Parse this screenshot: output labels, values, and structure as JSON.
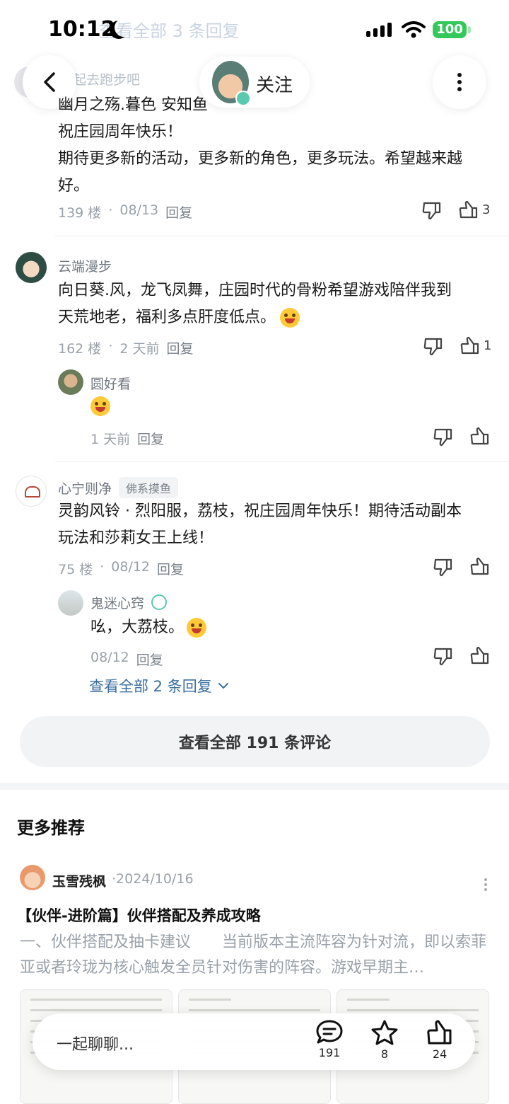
{
  "status": {
    "time": "10:12",
    "battery": "100"
  },
  "scroll_hint": "查看全部 3 条回复",
  "header": {
    "follow_label": "关注",
    "faded_title": "一起去跑步吧"
  },
  "comments": [
    {
      "name": "",
      "content": "幽月之殇.暮色 安知鱼\n祝庄园周年快乐！\n期待更多新的活动，更多新的角色，更多玩法。希望越来越好。",
      "line1": "幽月之殇.暮色 安知鱼",
      "line2": "祝庄园周年快乐！",
      "line3": "期待更多新的活动，更多新的角色，更多玩法。希望越来越",
      "line4": "好。",
      "floor": "139 楼",
      "date": "08/13",
      "reply": "回复",
      "likes": "3"
    },
    {
      "name": "云端漫步",
      "line1": "向日葵.风，龙飞凤舞，庄园时代的骨粉希望游戏陪伴我到",
      "line2": "天荒地老，福利多点肝度低点。",
      "floor": "162 楼",
      "date": "2 天前",
      "reply": "回复",
      "likes": "1",
      "sub": {
        "name": "圆好看",
        "date": "1 天前",
        "reply": "回复"
      }
    },
    {
      "name": "心宁则净",
      "tag": "佛系摸鱼",
      "line1": "灵韵风铃 · 烈阳服，荔枝，祝庄园周年快乐！期待活动副本",
      "line2": "玩法和莎莉女王上线！",
      "floor": "75 楼",
      "date": "08/12",
      "reply": "回复",
      "sub": {
        "name": "鬼迷心窍",
        "content": "吆，大荔枝。",
        "date": "08/12",
        "reply": "回复"
      },
      "view_replies": "查看全部 2 条回复"
    }
  ],
  "all_comments": "查看全部 191 条评论",
  "more": {
    "title": "更多推荐",
    "author": "玉雪残枫",
    "date": "·2024/10/16",
    "post_title": "【伙伴-进阶篇】伙伴搭配及养成攻略",
    "summary": "一、伙伴搭配及抽卡建议　　当前版本主流阵容为针对流，即以索菲亚或者玲珑为核心触发全员针对伤害的阵容。游戏早期主…"
  },
  "bottom_bar": {
    "placeholder": "一起聊聊...",
    "comments": "191",
    "favorites": "8",
    "likes": "24"
  },
  "colors": {
    "link": "#3b6fa0",
    "battery": "#34c759"
  }
}
